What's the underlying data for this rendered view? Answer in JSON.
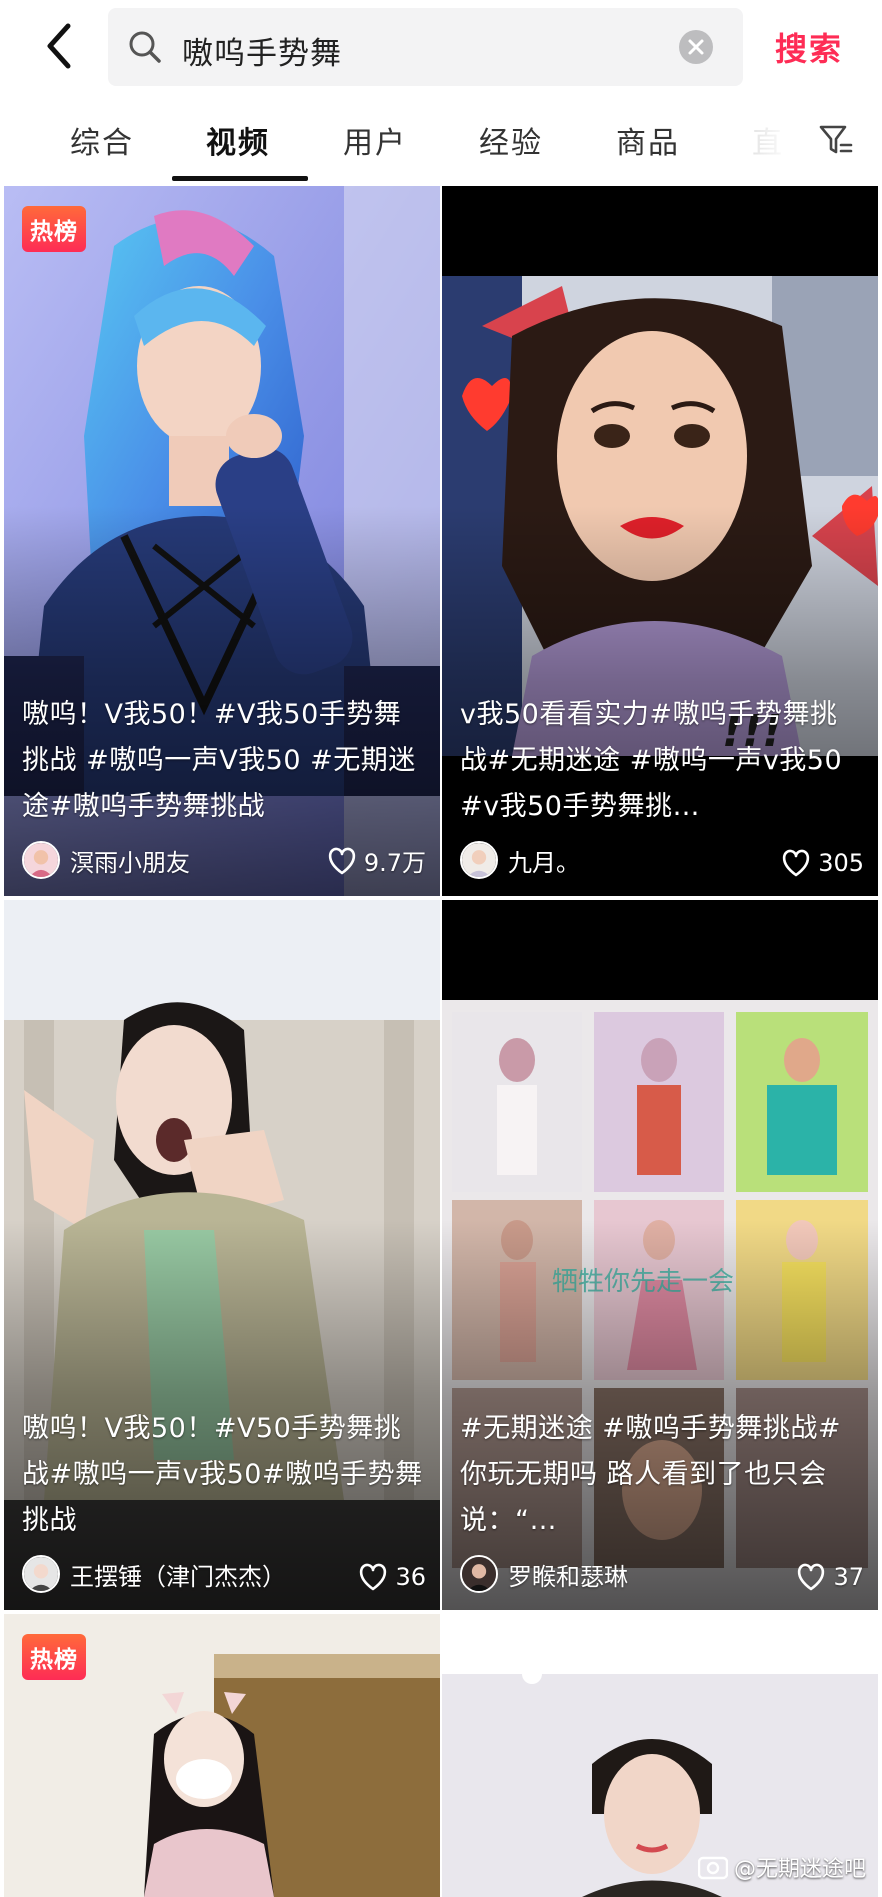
{
  "search": {
    "query": "嗷呜手势舞",
    "submit_label": "搜索"
  },
  "tabs": [
    {
      "label": "综合"
    },
    {
      "label": "视频",
      "active": true
    },
    {
      "label": "用户"
    },
    {
      "label": "经验"
    },
    {
      "label": "商品"
    },
    {
      "label": "直"
    }
  ],
  "colors": {
    "accent": "#fe2c55",
    "hot_badge": "#fe4b3c"
  },
  "cards": [
    {
      "hot_badge": "热榜",
      "caption": "嗷呜！V我50！#V我50手势舞挑战 #嗷呜一声V我50 #无期迷途#嗷呜手势舞挑战",
      "author": "溟雨小朋友",
      "likes": "9.7万"
    },
    {
      "caption": "v我50看看实力#嗷呜手势舞挑战#无期迷途 #嗷呜一声v我50 #v我50手势舞挑…",
      "author": "九月。",
      "likes": "305"
    },
    {
      "caption": "嗷呜！V我50！#V50手势舞挑战#嗷呜一声v我50#嗷呜手势舞挑战",
      "author": "王摆锤（津门杰杰）",
      "likes": "36"
    },
    {
      "caption": "#无期迷途 #嗷呜手势舞挑战#你玩无期吗 路人看到了也只会说：“…",
      "author": "罗睺和瑟琳",
      "likes": "37"
    },
    {
      "hot_badge": "热榜"
    },
    {}
  ],
  "watermark": "@无期迷途吧"
}
